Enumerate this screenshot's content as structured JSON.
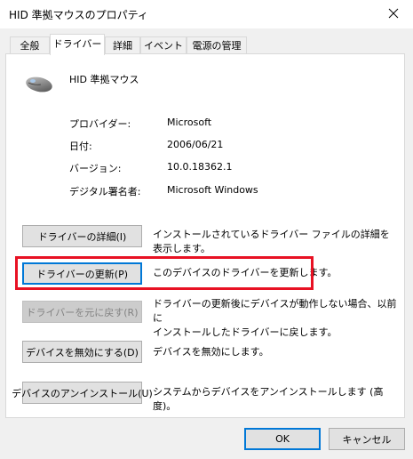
{
  "window": {
    "title": "HID 準拠マウスのプロパティ",
    "close_glyph": "✕"
  },
  "tabs": [
    {
      "label": "全般"
    },
    {
      "label": "ドライバー"
    },
    {
      "label": "詳細"
    },
    {
      "label": "イベント"
    },
    {
      "label": "電源の管理"
    }
  ],
  "device": {
    "name": "HID 準拠マウス",
    "icon": "mouse-icon"
  },
  "info": {
    "provider_label": "プロバイダー:",
    "provider_value": "Microsoft",
    "date_label": "日付:",
    "date_value": "2006/06/21",
    "version_label": "バージョン:",
    "version_value": "10.0.18362.1",
    "signer_label": "デジタル署名者:",
    "signer_value": "Microsoft Windows"
  },
  "actions": {
    "details_btn": "ドライバーの詳細(I)",
    "details_desc": "インストールされているドライバー ファイルの詳細を表示します。",
    "update_btn": "ドライバーの更新(P)",
    "update_desc": "このデバイスのドライバーを更新します。",
    "rollback_btn": "ドライバーを元に戻す(R)",
    "rollback_desc_1": "ドライバーの更新後にデバイスが動作しない場合、以前に",
    "rollback_desc_2": "インストールしたドライバーに戻します。",
    "disable_btn": "デバイスを無効にする(D)",
    "disable_desc": "デバイスを無効にします。",
    "uninstall_btn": "デバイスのアンインストール(U)",
    "uninstall_desc": "システムからデバイスをアンインストールします (高度)。"
  },
  "footer": {
    "ok": "OK",
    "cancel": "キャンセル"
  },
  "colors": {
    "highlight": "#e81123",
    "focus": "#0078d7"
  }
}
